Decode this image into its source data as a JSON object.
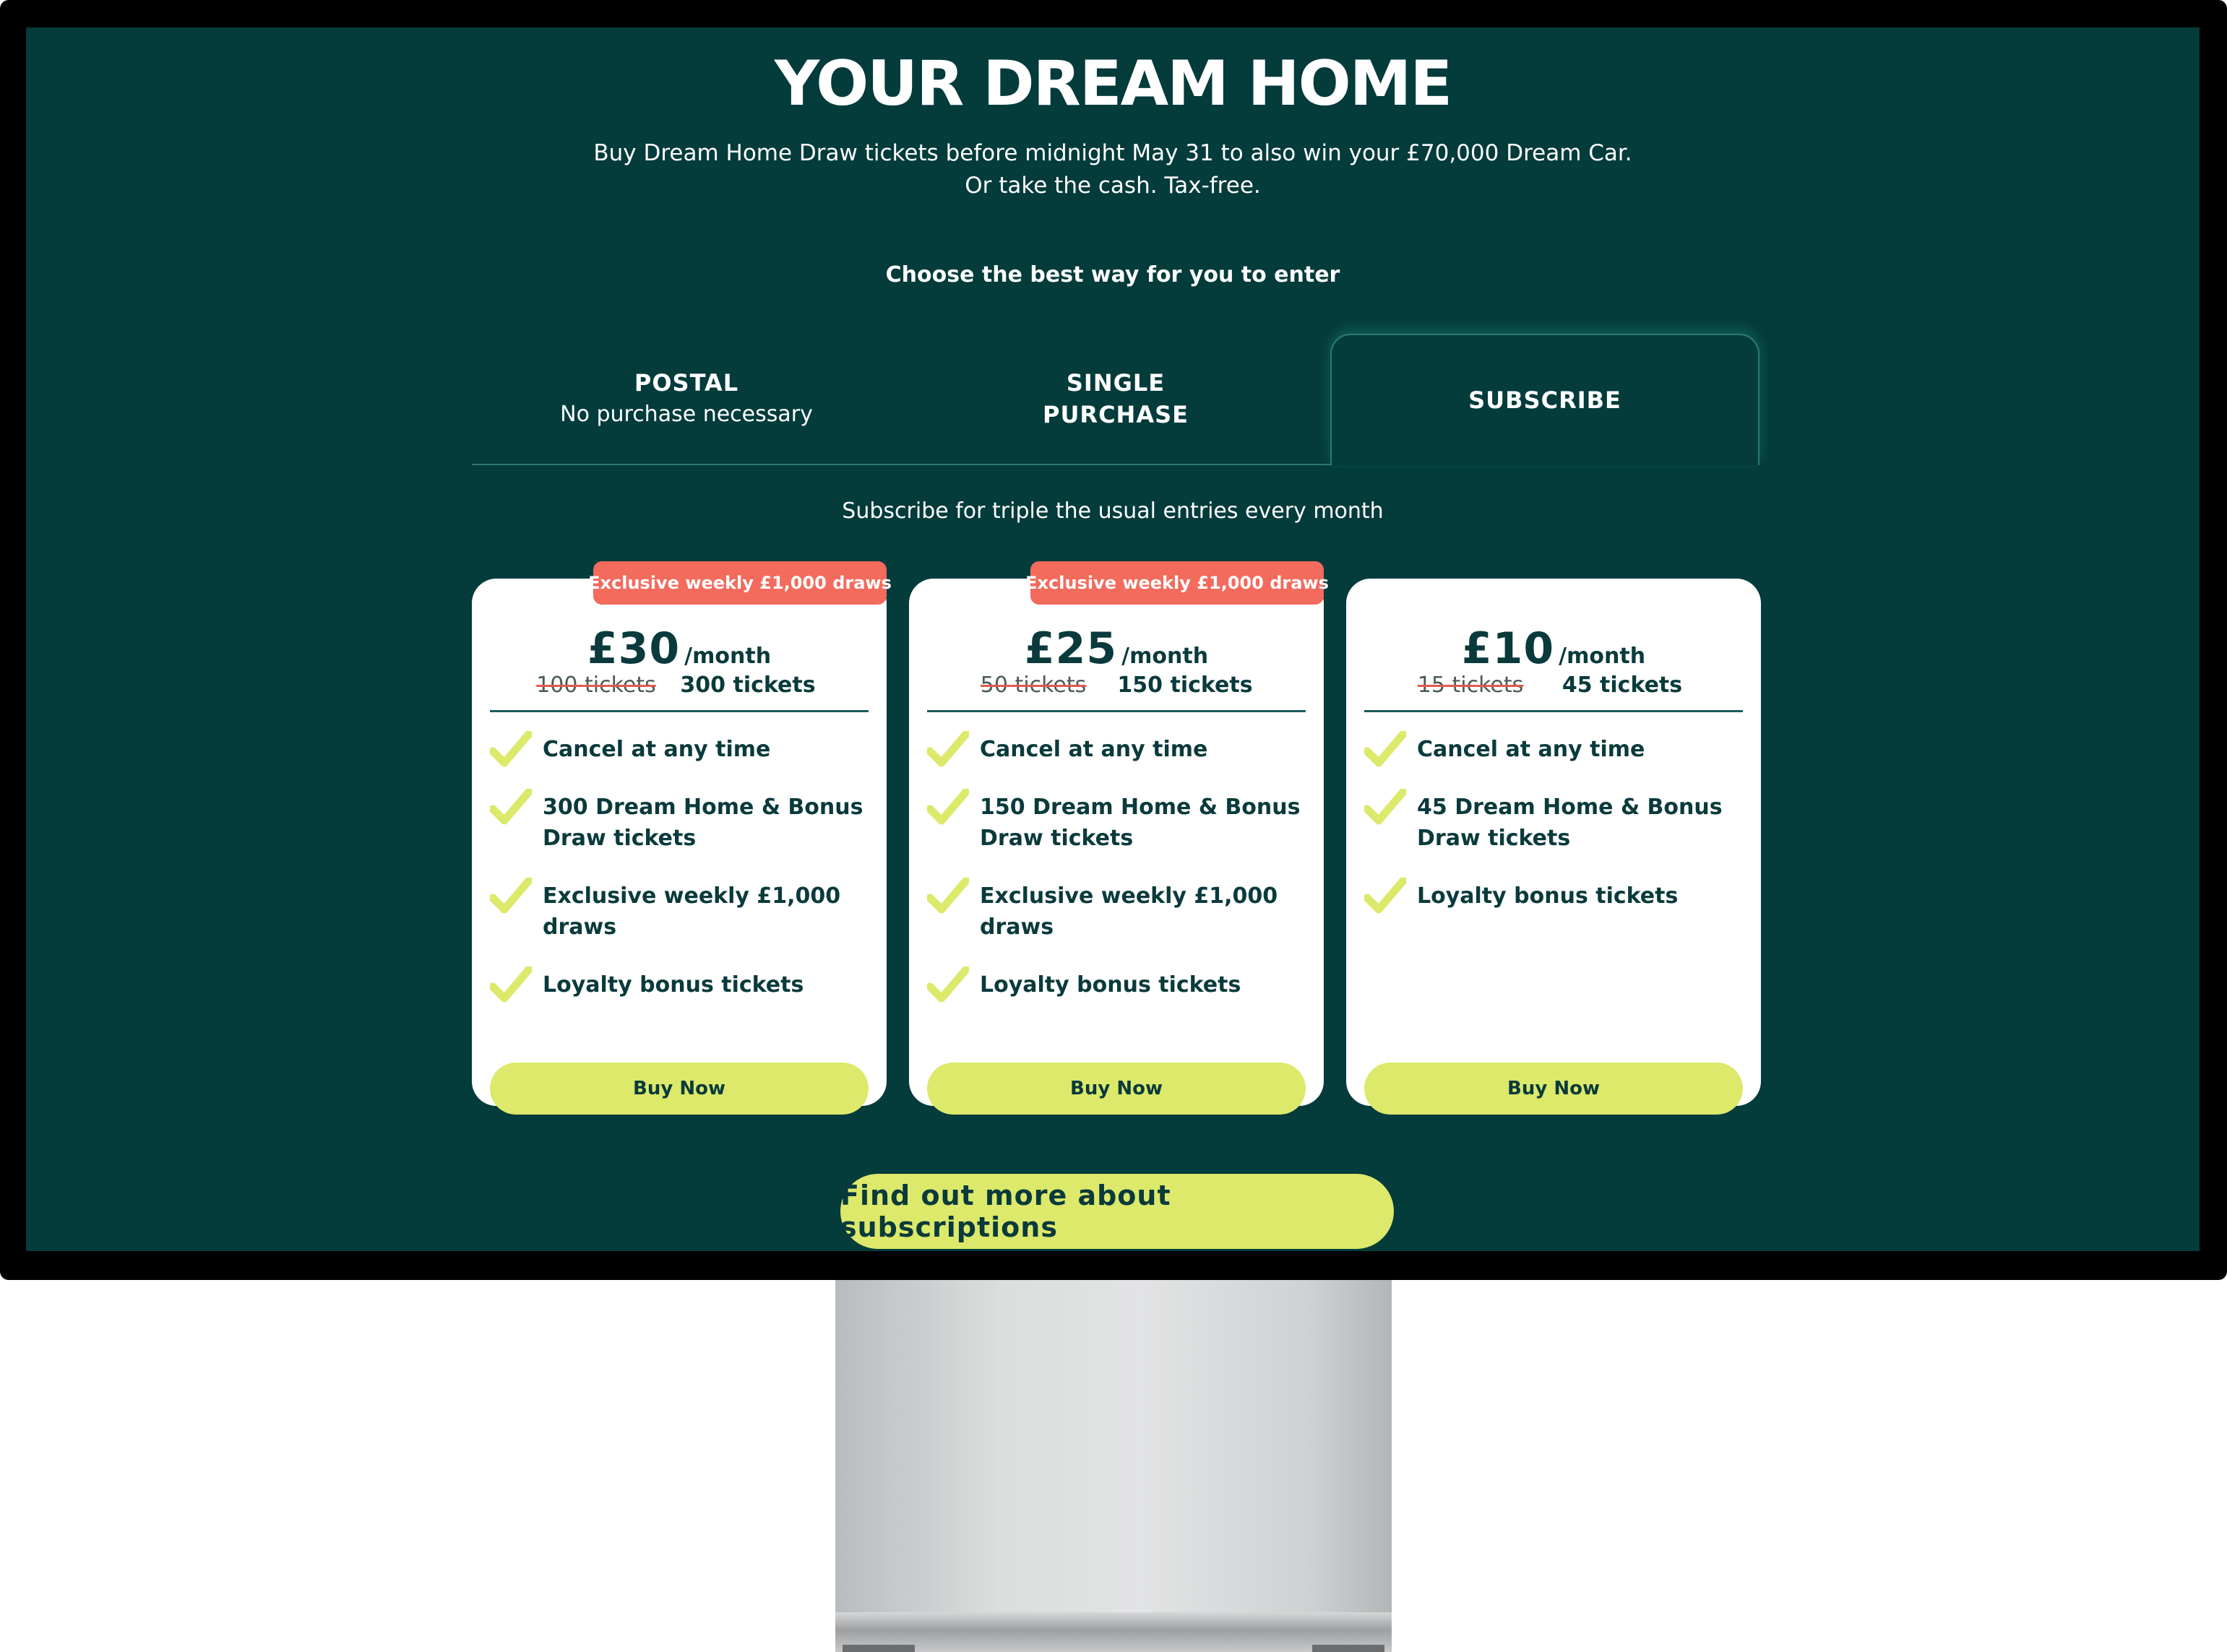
{
  "hero": {
    "title": "YOUR DREAM HOME",
    "subtitle_line1": "Buy Dream Home Draw tickets before midnight May 31 to also win your £70,000 Dream Car.",
    "subtitle_line2": "Or take the cash. Tax-free."
  },
  "choose_label": "Choose the best way for you to enter",
  "tabs": [
    {
      "title": "POSTAL",
      "desc": "No purchase necessary",
      "active": false
    },
    {
      "title": "SINGLE\nPURCHASE",
      "desc": "",
      "active": false
    },
    {
      "title": "SUBSCRIBE",
      "desc": "",
      "active": true
    }
  ],
  "subscribe_blurb": "Subscribe for triple the usual entries every month",
  "plans": [
    {
      "badge": "Exclusive weekly £1,000 draws",
      "price": "£30",
      "per": "/month",
      "old_tickets": "100 tickets",
      "new_tickets": "300 tickets",
      "features": [
        "Cancel at any time",
        "300 Dream Home & Bonus Draw tickets",
        "Exclusive weekly £1,000 draws",
        "Loyalty bonus tickets"
      ],
      "button": "Buy Now"
    },
    {
      "badge": "Exclusive weekly £1,000 draws",
      "price": "£25",
      "per": "/month",
      "old_tickets": "50 tickets",
      "new_tickets": "150 tickets",
      "features": [
        "Cancel at any time",
        "150 Dream Home & Bonus Draw tickets",
        "Exclusive weekly £1,000 draws",
        "Loyalty bonus tickets"
      ],
      "button": "Buy Now"
    },
    {
      "badge": "",
      "price": "£10",
      "per": "/month",
      "old_tickets": "15 tickets",
      "new_tickets": "45 tickets",
      "features": [
        "Cancel at any time",
        "45 Dream Home & Bonus Draw tickets",
        "Loyalty bonus tickets"
      ],
      "button": "Buy Now"
    }
  ],
  "more_button": "Find out more about subscriptions",
  "colors": {
    "background": "#043b3b",
    "accent": "#dce96a",
    "badge": "#f26b5d",
    "card": "#ffffff",
    "text_dark": "#0a3a3c"
  },
  "icons": {
    "feature": "checkmark-icon"
  }
}
